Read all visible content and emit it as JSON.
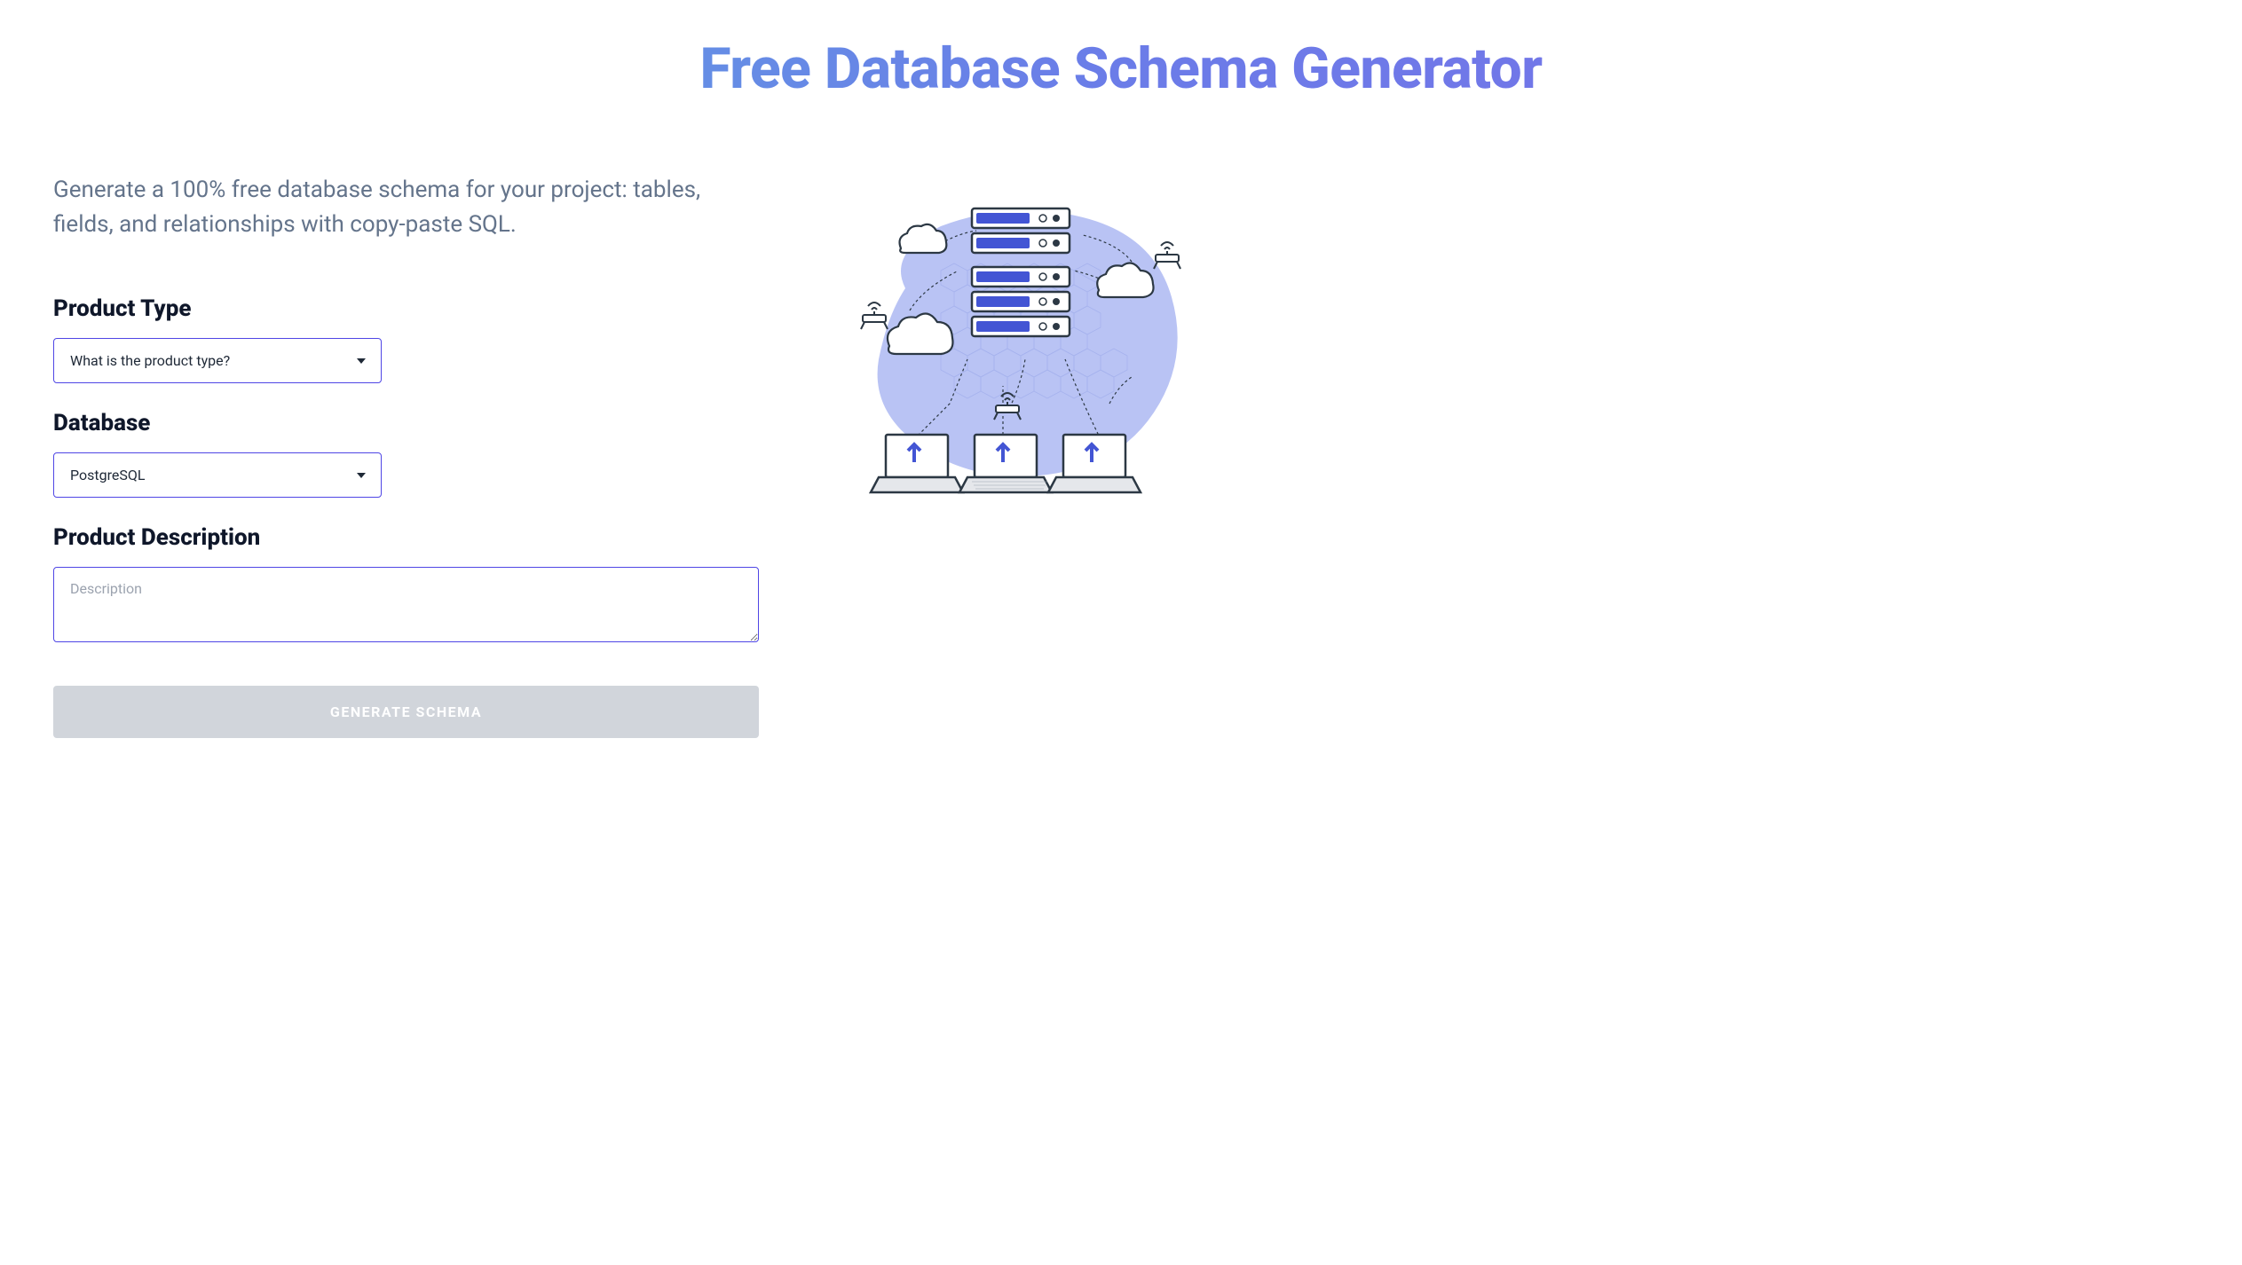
{
  "header": {
    "title": "Free Database Schema Generator"
  },
  "subtitle": "Generate a 100% free database schema for your project: tables, fields, and relationships with copy-paste SQL.",
  "form": {
    "productType": {
      "label": "Product Type",
      "placeholder": "What is the product type?"
    },
    "database": {
      "label": "Database",
      "value": "PostgreSQL"
    },
    "description": {
      "label": "Product Description",
      "placeholder": "Description"
    },
    "submit": {
      "label": "GENERATE SCHEMA"
    }
  }
}
